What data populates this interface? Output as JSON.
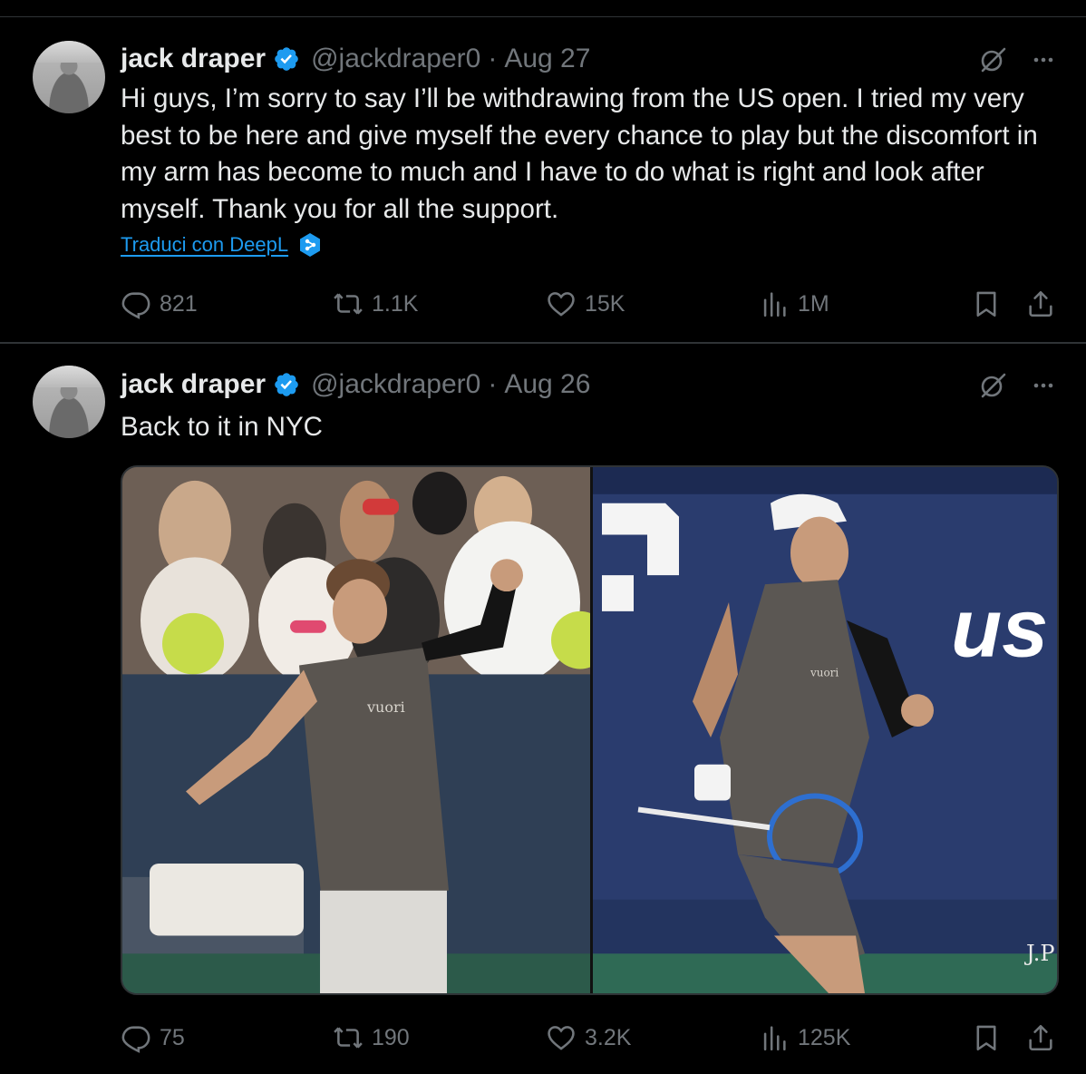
{
  "tweets": [
    {
      "author_name": "jack draper",
      "handle": "@jackdraper0",
      "separator": "·",
      "date": "Aug 27",
      "text": "Hi guys, I’m sorry to say I’ll be withdrawing from the US open. I tried my very best to be here and give myself the every chance to play but the discomfort in my arm has become to much and I have to do what is right and look after myself. Thank you for all the support.",
      "translate_label": "Traduci con DeepL",
      "replies": "821",
      "reposts": "1.1K",
      "likes": "15K",
      "views": "1M"
    },
    {
      "author_name": "jack draper",
      "handle": "@jackdraper0",
      "separator": "·",
      "date": "Aug 26",
      "text": "Back to it in NYC",
      "photo_texts": [
        "vuori",
        "us",
        "vuori",
        "J.P"
      ],
      "replies": "75",
      "reposts": "190",
      "likes": "3.2K",
      "views": "125K"
    }
  ],
  "colors": {
    "background": "#000000",
    "text": "#e7e9ea",
    "muted": "#71767b",
    "divider": "#2f3336",
    "link": "#1d9bf0",
    "verified": "#1d9bf0"
  },
  "icons": {
    "verified": "verified-badge-icon",
    "grok": "grok-icon",
    "more": "more-icon",
    "reply": "reply-icon",
    "repost": "repost-icon",
    "like": "like-icon",
    "views": "views-icon",
    "bookmark": "bookmark-icon",
    "share": "share-icon",
    "deepl": "deepl-icon"
  }
}
